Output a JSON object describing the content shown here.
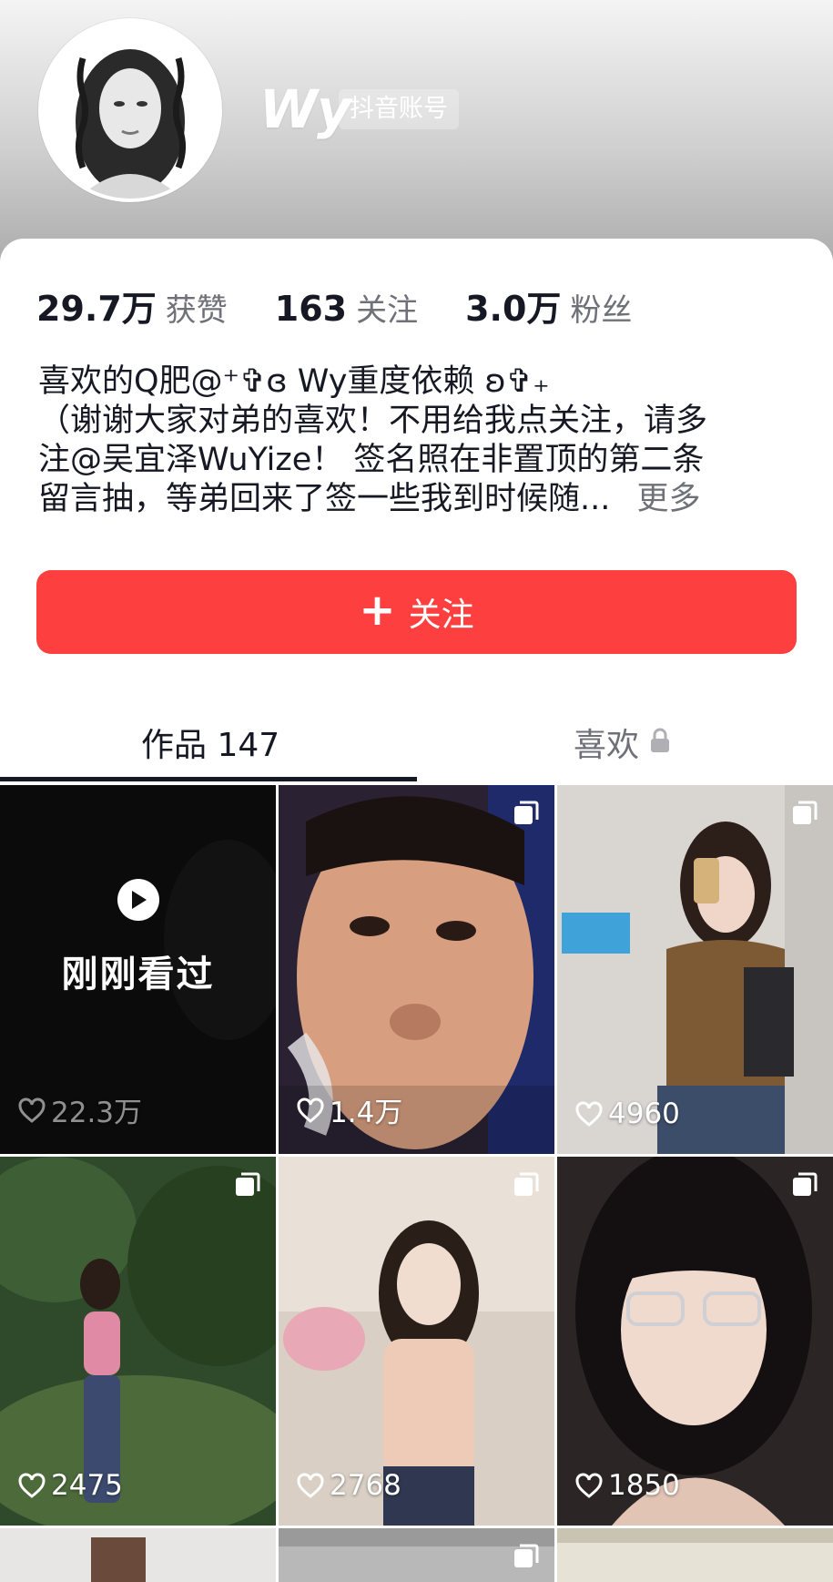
{
  "profile": {
    "nickname": "Wy",
    "account_tag": "抖音账号"
  },
  "stats": [
    {
      "value": "29.7万",
      "label": "获赞"
    },
    {
      "value": "163",
      "label": "关注"
    },
    {
      "value": "3.0万",
      "label": "粉丝"
    }
  ],
  "bio": {
    "line1": "喜欢的Q肥@⁺✞ɞ Wy重度依赖 ʚ✞₊",
    "line2": "（谢谢大家对弟的喜欢！不用给我点关注，请多",
    "line3": "注@吴宜泽WuYize！ 签名照在非置顶的第二条",
    "line4": "留言抽，等弟回来了签一些我到时候随...",
    "more": "更多"
  },
  "follow_button": {
    "label": "关注",
    "icon": "plus-icon"
  },
  "tabs": {
    "works": "作品 147",
    "likes": "喜欢",
    "likes_icon": "lock-icon"
  },
  "recent_label": "刚刚看过",
  "videos": [
    {
      "likes": "22.3万",
      "recent": true
    },
    {
      "likes": "1.4万",
      "multi": true
    },
    {
      "likes": "4960",
      "multi": true
    },
    {
      "likes": "2475",
      "multi": true
    },
    {
      "likes": "2768",
      "multi": true
    },
    {
      "likes": "1850",
      "multi": true
    }
  ],
  "colors": {
    "accent": "#fe3f3f",
    "text_primary": "#161823",
    "text_secondary": "#6f7078"
  }
}
